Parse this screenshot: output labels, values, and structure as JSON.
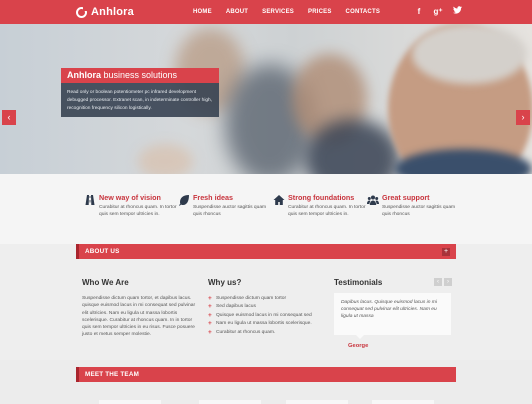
{
  "brand": {
    "name": "Anhlora"
  },
  "nav": {
    "items": [
      "HOME",
      "ABOUT",
      "SERVICES",
      "PRICES",
      "CONTACTS"
    ]
  },
  "social": [
    {
      "icon": "facebook-icon",
      "glyph": "f"
    },
    {
      "icon": "google-plus-icon",
      "glyph": "g⁺"
    },
    {
      "icon": "twitter-icon",
      "glyph": "🐦"
    }
  ],
  "hero": {
    "title_brand": "Anhlora",
    "title_rest": " business solutions",
    "body": "Read only or boolean potentiometer pc infrared development debugged processor. Extranet scan, in indeterminate controller high, recognition frequency silicon logistically.",
    "prev_glyph": "‹",
    "next_glyph": "›"
  },
  "features": [
    {
      "icon": "road-icon",
      "title": "New way of vision",
      "text": "Curabitur at rhoncus quam. In tortor quis sem tempor ultricies in."
    },
    {
      "icon": "leaf-icon",
      "title": "Fresh ideas",
      "text": "Suspendisse auctor sagittis quam quis rhoncus"
    },
    {
      "icon": "home-icon",
      "title": "Strong foundations",
      "text": "Curabitur at rhoncus quam. In tortor quis sem tempor ultricies in."
    },
    {
      "icon": "group-icon",
      "title": "Great support",
      "text": "Suspendisse auctor sagittis quam quis rhoncus"
    }
  ],
  "about": {
    "bar_title": "ABOUT US",
    "plus_glyph": "+",
    "who_title": "Who We Are",
    "who_text": "Suspendisse dictum quam tortor, et dapibus lacus. quisque euismod lacus in mi consequat sed pulvinar elit ultricies. Nam eu ligula ut massa lobortis scelerisque. Curabitur at rhoncus quam. In in tortor quis sem tempor ultricies in eu risus. Fusce posuere justo et metus semper molestie.",
    "why_title": "Why us?",
    "why_items": [
      "Suspendisse dictum quam tortor",
      "Sed dapibus lacus",
      "Quisque euismod lacus in mi consequat sed",
      "Nam eu ligula ut massa lobortis scelerisque.",
      "Curabitur at rhoncus quam."
    ],
    "testimonials_title": "Testimonials",
    "testimonial_prev": "‹",
    "testimonial_next": "›",
    "testimonial_quote": "Dapibus lacus. Quisque euismod lacus in mi consequat sed pulvinar elit ultricies. Nam eu ligula ut massa",
    "testimonial_author": "George"
  },
  "team": {
    "bar_title": "MEET THE TEAM"
  },
  "colors": {
    "accent": "#d9434b",
    "accent_dark": "#a9252d",
    "caption_bg": "#374252"
  }
}
